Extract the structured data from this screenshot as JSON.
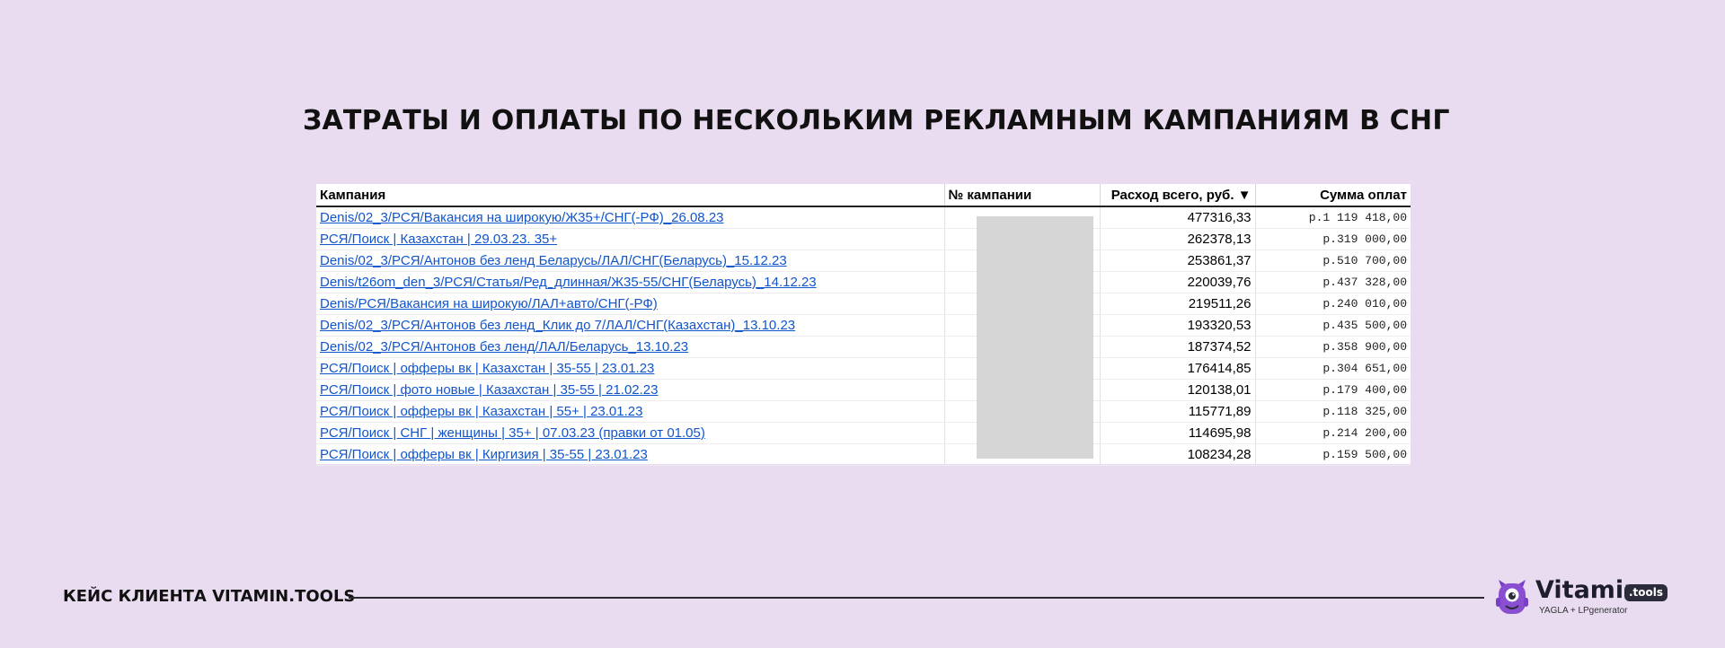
{
  "page": {
    "title": "ЗАТРАТЫ И ОПЛАТЫ ПО НЕСКОЛЬКИМ РЕКЛАМНЫМ КАМПАНИЯМ В СНГ",
    "footer_text": "КЕЙС КЛИЕНТА VITAMIN.TOOLS"
  },
  "logo": {
    "name": "Vitamin",
    "badge": ".tools",
    "subtitle": "YAGLA + LPgenerator",
    "colors": {
      "purple": "#8a4fd0",
      "dark": "#2b2b3a"
    }
  },
  "table": {
    "headers": {
      "campaign": "Кампания",
      "number": "№ кампании",
      "spend": "Расход всего, руб. ▼",
      "payments": "Сумма оплат"
    },
    "rows": [
      {
        "campaign": "Denis/02_3/РСЯ/Вакансия на широкую/Ж35+/СНГ(-РФ)_26.08.23",
        "spend": "477316,33",
        "payments": "р.1 119 418,00"
      },
      {
        "campaign": "РСЯ/Поиск | Казахстан | 29.03.23. 35+",
        "spend": "262378,13",
        "payments": "р.319 000,00"
      },
      {
        "campaign": "Denis/02_3/РСЯ/Антонов без ленд Беларусь/ЛАЛ/СНГ(Беларусь)_15.12.23",
        "spend": "253861,37",
        "payments": "р.510 700,00"
      },
      {
        "campaign": "Denis/t26om_den_3/РСЯ/Статья/Ред_длинная/Ж35-55/СНГ(Беларусь)_14.12.23",
        "spend": "220039,76",
        "payments": "р.437 328,00"
      },
      {
        "campaign": "Denis/РСЯ/Вакансия на широкую/ЛАЛ+авто/СНГ(-РФ)",
        "spend": "219511,26",
        "payments": "р.240 010,00"
      },
      {
        "campaign": "Denis/02_3/РСЯ/Антонов без ленд_Клик до 7/ЛАЛ/СНГ(Казахстан)_13.10.23",
        "spend": "193320,53",
        "payments": "р.435 500,00"
      },
      {
        "campaign": "Denis/02_3/РСЯ/Антонов без ленд/ЛАЛ/Беларусь_13.10.23",
        "spend": "187374,52",
        "payments": "р.358 900,00"
      },
      {
        "campaign": "РСЯ/Поиск | офферы вк | Казахстан | 35-55 | 23.01.23",
        "spend": "176414,85",
        "payments": "р.304 651,00"
      },
      {
        "campaign": "РСЯ/Поиск | фото новые | Казахстан | 35-55 | 21.02.23",
        "spend": "120138,01",
        "payments": "р.179 400,00"
      },
      {
        "campaign": "РСЯ/Поиск | офферы вк | Казахстан | 55+ | 23.01.23",
        "spend": "115771,89",
        "payments": "р.118 325,00"
      },
      {
        "campaign": "РСЯ/Поиск | СНГ | женщины | 35+ | 07.03.23 (правки от 01.05)",
        "spend": "114695,98",
        "payments": "р.214 200,00"
      },
      {
        "campaign": "РСЯ/Поиск | офферы вк | Киргизия | 35-55 | 23.01.23",
        "spend": "108234,28",
        "payments": "р.159 500,00"
      }
    ]
  }
}
